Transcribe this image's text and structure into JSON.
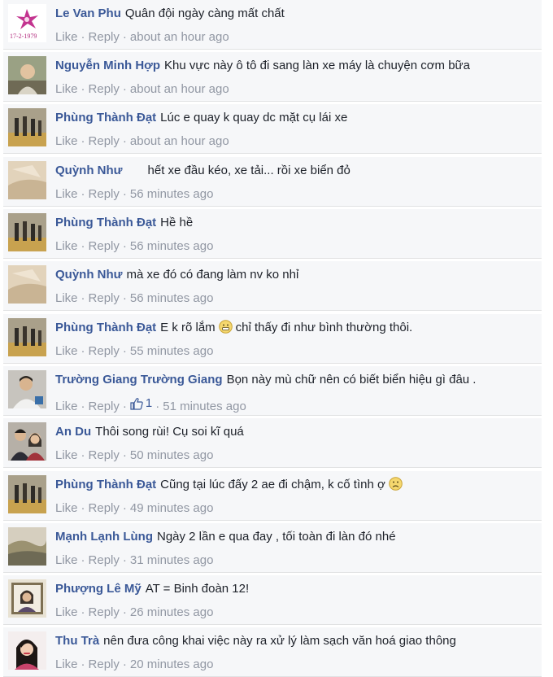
{
  "actions": {
    "like": "Like",
    "reply": "Reply",
    "separator": "·"
  },
  "comments": [
    {
      "author": "Le Van Phu",
      "text": "Quân đội ngày càng mất chất",
      "time": "about an hour ago",
      "avatar": "pink-flower-1979-avatar",
      "avatar_caption": "17-2-1979"
    },
    {
      "author": "Nguyễn Minh Hợp",
      "text": "Khu vực này ô tô đi sang làn xe máy là chuyện cơm bữa",
      "time": "about an hour ago",
      "avatar": "man-photo-avatar"
    },
    {
      "author": "Phùng Thành Đạt",
      "text": "Lúc e quay k quay dc mặt cụ lái xe",
      "time": "about an hour ago",
      "avatar": "group-outdoor-avatar"
    },
    {
      "author": "Quỳnh Như",
      "text": "hết xe đầu kéo, xe tải... rồi xe biển đỏ",
      "time": "56 minutes ago",
      "avatar": "beige-sepia-avatar",
      "text_indent": true
    },
    {
      "author": "Phùng Thành Đạt",
      "text": "Hề hề",
      "time": "56 minutes ago",
      "avatar": "group-outdoor-avatar"
    },
    {
      "author": "Quỳnh Như",
      "text": "mà xe đó có đang làm nv ko nhỉ",
      "time": "56 minutes ago",
      "avatar": "beige-sepia-avatar"
    },
    {
      "author": "Phùng Thành Đạt",
      "text_before": "E k rõ lắm",
      "text_after": "chỉ thấy đi như bình thường thôi.",
      "emoji": "grin-emoji",
      "time": "55 minutes ago",
      "avatar": "group-outdoor-avatar"
    },
    {
      "author": "Trường Giang Trường Giang",
      "text": "Bọn này mù chữ nên có biết biển hiệu gì đâu .",
      "time": "51 minutes ago",
      "avatar": "man-white-shirt-avatar",
      "like_count": "1"
    },
    {
      "author": "An Du",
      "text": "Thôi song rùi! Cụ soi kĩ quá",
      "time": "50 minutes ago",
      "avatar": "couple-photo-avatar"
    },
    {
      "author": "Phùng Thành Đạt",
      "text_before": "Cũng tại lúc đấy 2 ae đi chậm, k cố tình ợ",
      "text_after": "",
      "emoji": "frown-emoji",
      "time": "49 minutes ago",
      "avatar": "group-outdoor-avatar"
    },
    {
      "author": "Mạnh Lạnh Lùng",
      "text": "Ngày 2 lần e qua đay , tối toàn đi làn đó nhé",
      "time": "31 minutes ago",
      "avatar": "landscape-avatar"
    },
    {
      "author": "Phượng Lê Mỹ",
      "text": "AT = Binh đoàn 12!",
      "time": "26 minutes ago",
      "avatar": "framed-portrait-avatar"
    },
    {
      "author": "Thu Trà",
      "text": "nên đưa công khai việc này ra xử lý làm sạch văn hoá giao thông",
      "time": "20 minutes ago",
      "avatar": "woman-portrait-avatar"
    }
  ],
  "colors": {
    "author": "#3b5998",
    "meta": "#9197a3",
    "row_bg": "#f6f7f9",
    "divider": "#e1e2e3"
  }
}
